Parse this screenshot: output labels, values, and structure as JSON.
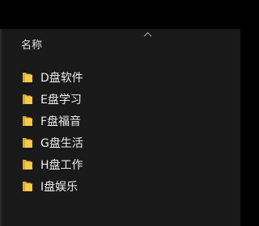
{
  "header": {
    "name_column_label": "名称",
    "sort_icon": "chevron-up-icon"
  },
  "files": [
    {
      "name": "D盘软件",
      "icon": "folder-icon"
    },
    {
      "name": "E盘学习",
      "icon": "folder-icon"
    },
    {
      "name": "F盘福音",
      "icon": "folder-icon"
    },
    {
      "name": "G盘生活",
      "icon": "folder-icon"
    },
    {
      "name": "H盘工作",
      "icon": "folder-icon"
    },
    {
      "name": "I盘娱乐",
      "icon": "folder-icon"
    }
  ],
  "colors": {
    "background": "#000000",
    "panel": "#191919",
    "text": "#ededed",
    "folder_front": "#f5c94a",
    "folder_back": "#dba82f"
  }
}
